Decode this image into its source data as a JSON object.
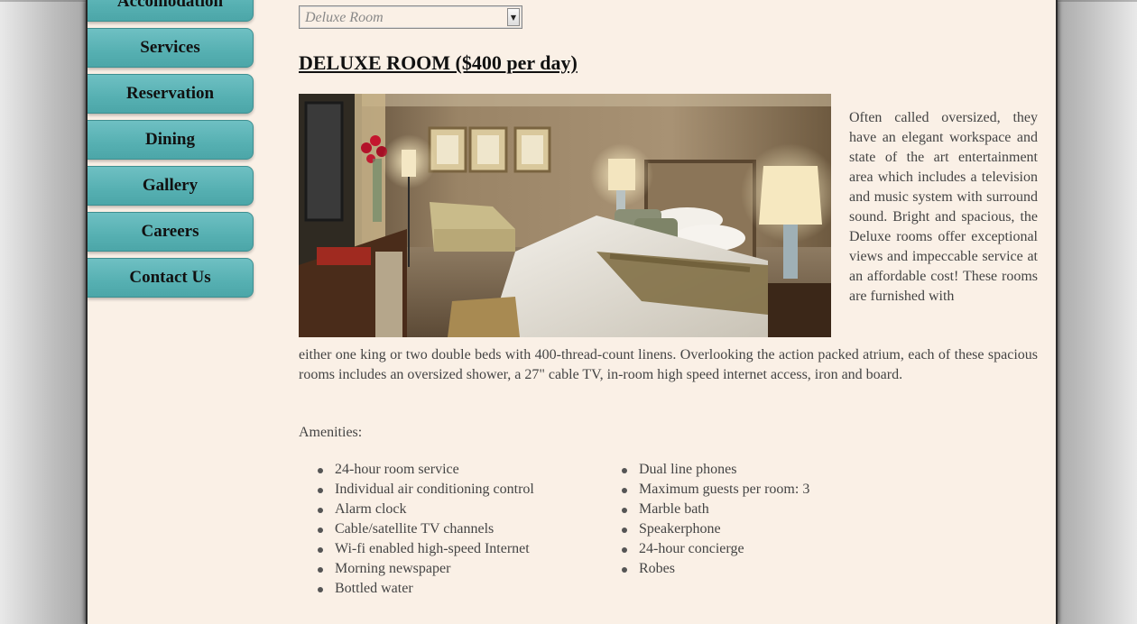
{
  "nav": {
    "items": [
      {
        "label": "Accomodation"
      },
      {
        "label": "Services"
      },
      {
        "label": "Reservation"
      },
      {
        "label": "Dining"
      },
      {
        "label": "Gallery"
      },
      {
        "label": "Careers"
      },
      {
        "label": "Contact Us"
      }
    ]
  },
  "room_select": {
    "selected": "Deluxe Room"
  },
  "room": {
    "title": "DELUXE ROOM ($400 per day)",
    "photo_icon": "hotel-room-photo",
    "description_side": "Often called oversized, they have an elegant workspace and state of the art entertainment area which includes a television and music system with surround sound. Bright and spacious, the Deluxe rooms offer exceptional views and impeccable service at an affordable cost! These rooms are furnished with",
    "description_bottom": "either one king or two double beds with 400-thread-count linens. Overlooking the action packed atrium, each of these spacious rooms includes an oversized shower, a 27\" cable TV, in-room high speed internet access, iron and board."
  },
  "amenities": {
    "label": "Amenities:",
    "left": [
      "24-hour room service",
      "Individual air conditioning control",
      "Alarm clock",
      "Cable/satellite TV channels",
      "Wi-fi enabled high-speed Internet",
      "Morning newspaper",
      "Bottled water"
    ],
    "right": [
      "Dual line phones",
      "Maximum guests per room: 3",
      "Marble bath",
      "Speakerphone",
      "24-hour concierge",
      "Robes"
    ]
  },
  "colors": {
    "nav_button": "#5ab4b6",
    "page_background": "#faf0e6",
    "text": "#444444"
  }
}
